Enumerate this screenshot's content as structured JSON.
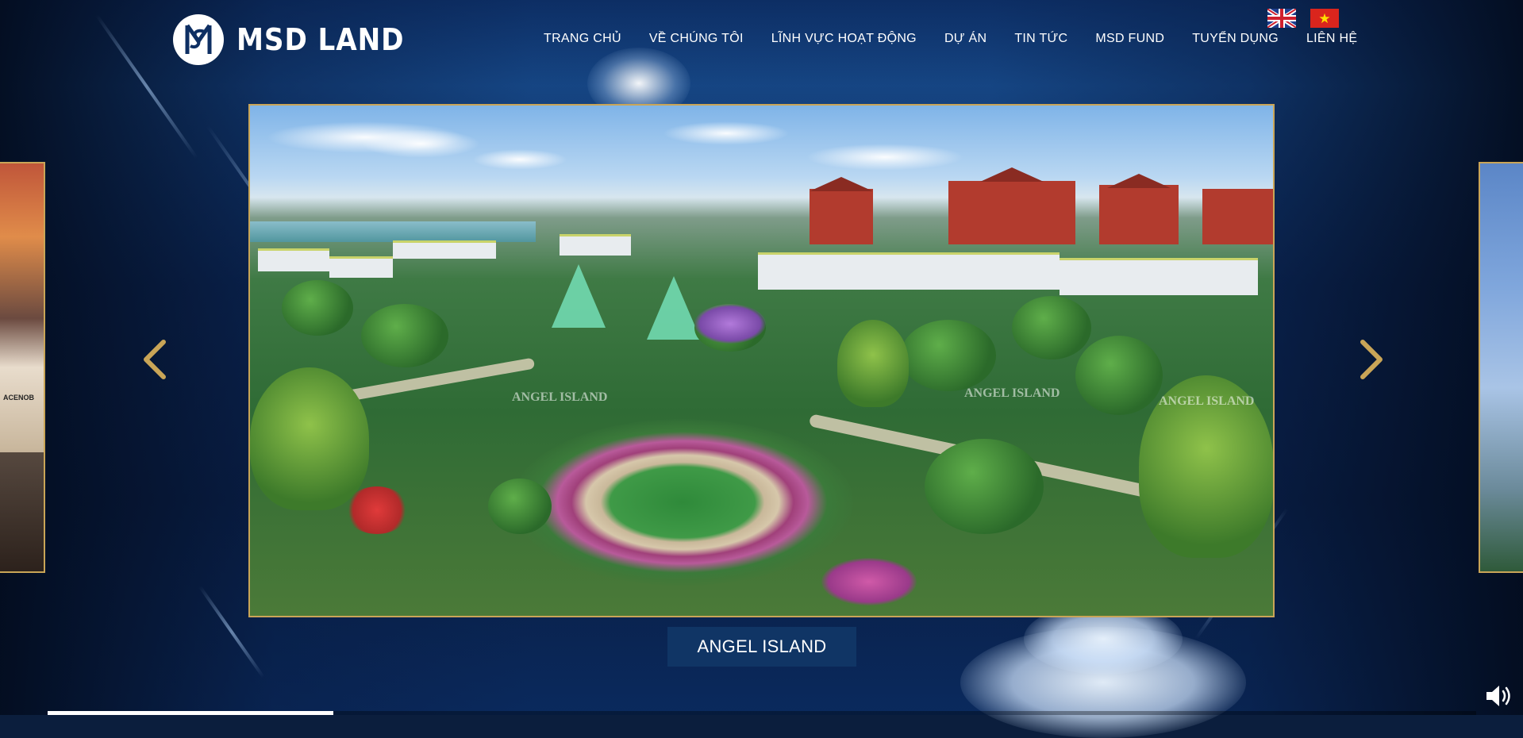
{
  "brand": {
    "name": "MSD LAND",
    "logo_icon": "msd-logo-icon"
  },
  "nav": {
    "items": [
      {
        "label": "TRANG CHỦ"
      },
      {
        "label": "VỀ CHÚNG TÔI"
      },
      {
        "label": "LĨNH VỰC HOẠT ĐỘNG"
      },
      {
        "label": "DỰ ÁN"
      },
      {
        "label": "TIN TỨC"
      },
      {
        "label": "MSD FUND"
      },
      {
        "label": "TUYỂN DỤNG"
      },
      {
        "label": "LIÊN HỆ"
      }
    ]
  },
  "languages": [
    {
      "icon": "uk-flag-icon"
    },
    {
      "icon": "vietnam-flag-icon"
    }
  ],
  "slider": {
    "current_caption": "ANGEL ISLAND",
    "watermark_text": "ANGEL ISLAND",
    "left_peek_text": "ACENOB",
    "progress_fraction": 0.2,
    "prev_icon": "chevron-left-icon",
    "next_icon": "chevron-right-icon"
  },
  "audio": {
    "icon": "speaker-icon"
  },
  "colors": {
    "accent_gold": "#c9a557",
    "caption_bg": "#103565",
    "nav_text": "#ffffff"
  }
}
